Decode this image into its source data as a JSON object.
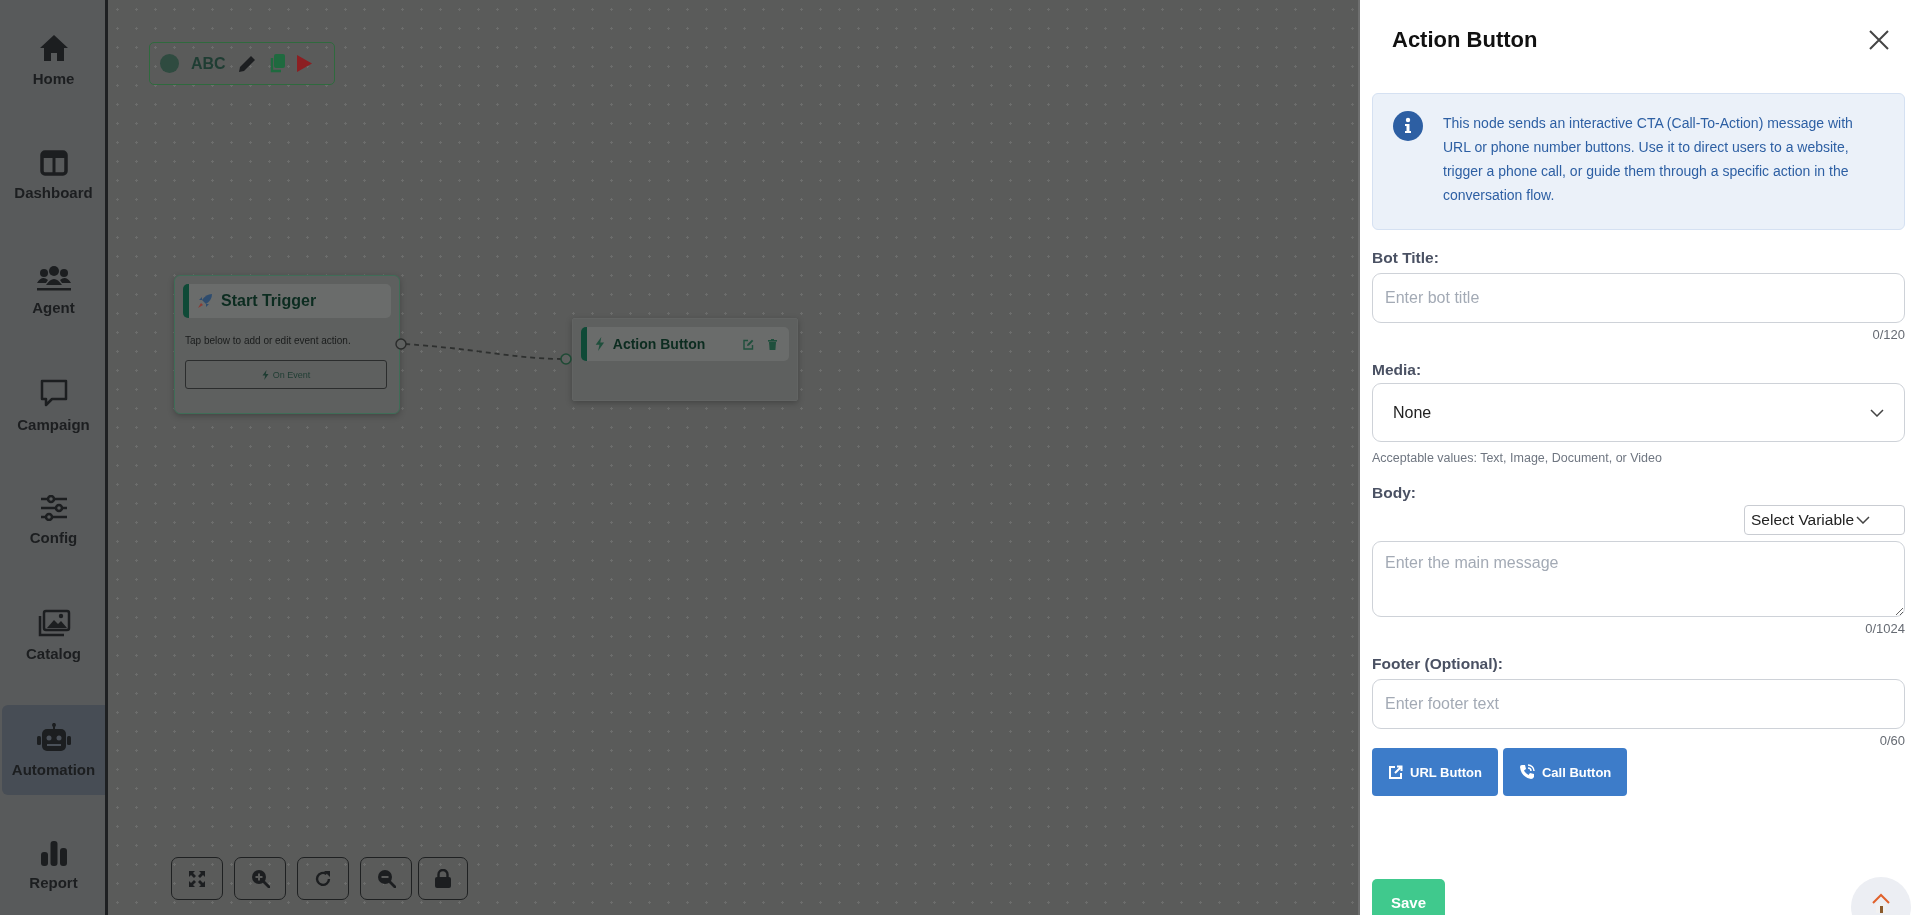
{
  "sidebar": {
    "items": [
      {
        "label": "Home",
        "selected": false
      },
      {
        "label": "Dashboard",
        "selected": false
      },
      {
        "label": "Agent",
        "selected": false
      },
      {
        "label": "Campaign",
        "selected": false
      },
      {
        "label": "Config",
        "selected": false
      },
      {
        "label": "Catalog",
        "selected": false
      },
      {
        "label": "Automation",
        "selected": true
      },
      {
        "label": "Report",
        "selected": false
      }
    ]
  },
  "canvas": {
    "toolbar": {
      "label": "ABC"
    },
    "nodes": [
      {
        "kind": "trigger",
        "title": "Start Trigger",
        "description": "Tap below to add or edit event action.",
        "button": "On Event"
      },
      {
        "kind": "action",
        "title": "Action Button"
      }
    ]
  },
  "panel": {
    "title": "Action Button",
    "info": "This node sends an interactive CTA (Call-To-Action) message with URL or phone number buttons. Use it to direct users to a website, trigger a phone call, or guide them through a specific action in the conversation flow.",
    "fields": [
      {
        "kind": "input",
        "label": "Bot Title:",
        "placeholder": "Enter bot title",
        "counter": "0/120"
      },
      {
        "kind": "select",
        "label": "Media:",
        "value": "None",
        "hint": "Acceptable values: Text, Image, Document, or Video"
      },
      {
        "kind": "textarea",
        "label": "Body:",
        "variable_select": "Select Variable",
        "placeholder": "Enter the main message",
        "counter": "0/1024"
      },
      {
        "kind": "input",
        "label": "Footer (Optional):",
        "placeholder": "Enter footer text",
        "counter": "0/60"
      }
    ],
    "buttons": [
      {
        "kind": "url",
        "label": "URL Button"
      },
      {
        "kind": "call",
        "label": "Call Button"
      }
    ],
    "save": "Save"
  }
}
